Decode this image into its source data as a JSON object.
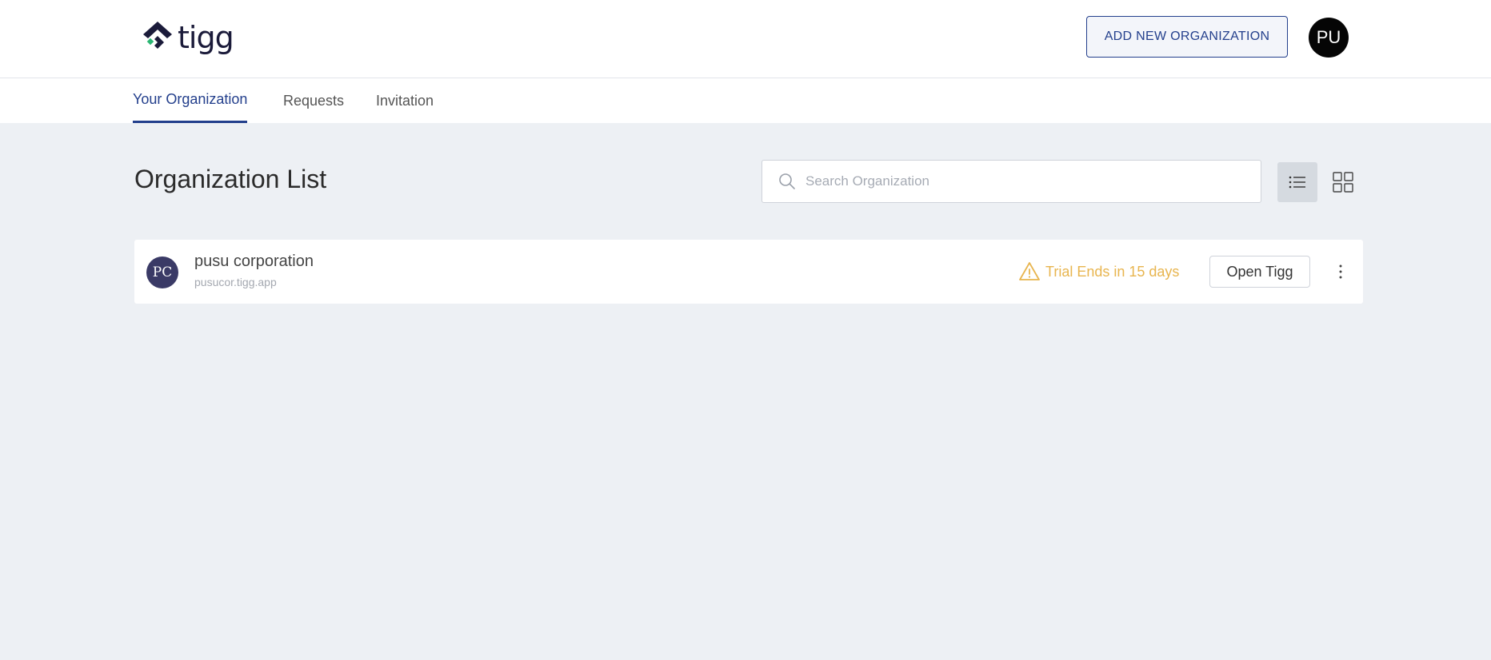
{
  "header": {
    "logo_text": "tigg",
    "add_button_label": "ADD NEW ORGANIZATION",
    "user_initials": "PU"
  },
  "tabs": [
    {
      "label": "Your Organization",
      "active": true
    },
    {
      "label": "Requests",
      "active": false
    },
    {
      "label": "Invitation",
      "active": false
    }
  ],
  "main": {
    "title": "Organization List",
    "search": {
      "placeholder": "Search Organization",
      "value": ""
    },
    "view_modes": [
      "list-view",
      "grid-view"
    ],
    "active_view": "list-view"
  },
  "organizations": [
    {
      "initials": "PC",
      "name": "pusu corporation",
      "domain": "pusucor.tigg.app",
      "trial_status": "Trial Ends in 15 days",
      "action_label": "Open Tigg"
    }
  ],
  "colors": {
    "primary": "#233f8c",
    "warning": "#e8b54f",
    "background": "#edf0f4",
    "org_avatar": "#3a3a66"
  }
}
